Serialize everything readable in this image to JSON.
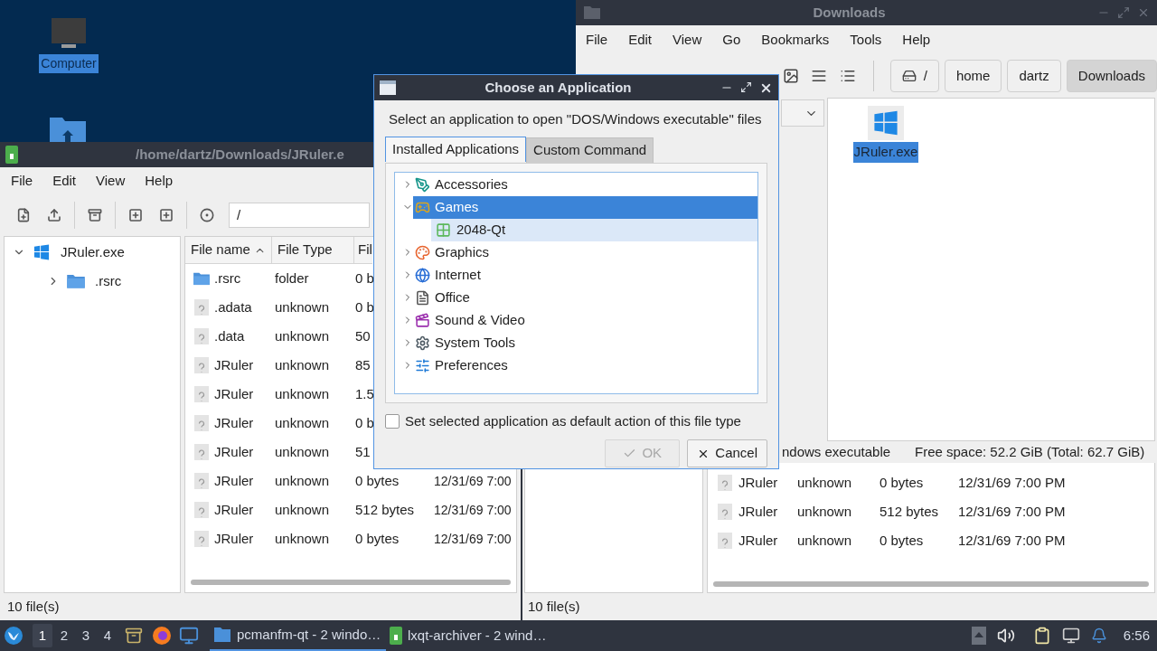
{
  "desktop_icons": [
    {
      "kind": "computer",
      "label": "Computer",
      "selected": true
    },
    {
      "kind": "home-folder",
      "selected": false
    }
  ],
  "archiver_back": {
    "rows": [
      {
        "kind": "unknown",
        "name": "JRuler",
        "type": "unknown",
        "size": "0 bytes",
        "date": "12/31/69 7:00 PM"
      },
      {
        "kind": "unknown",
        "name": "JRuler",
        "type": "unknown",
        "size": "512 bytes",
        "date": "12/31/69 7:00 PM"
      },
      {
        "kind": "unknown",
        "name": "JRuler",
        "type": "unknown",
        "size": "0 bytes",
        "date": "12/31/69 7:00 PM"
      }
    ],
    "status": "10 file(s)"
  },
  "downloads_window": {
    "title": "Downloads",
    "menu": [
      "File",
      "Edit",
      "View",
      "Go",
      "Bookmarks",
      "Tools",
      "Help"
    ],
    "view_buttons": [
      {
        "kind": "thumbnail",
        "selected": false
      },
      {
        "kind": "compact",
        "selected": false
      },
      {
        "kind": "detailed",
        "selected": false
      }
    ],
    "path": [
      {
        "label": "/",
        "kind": "root",
        "selected": false
      },
      {
        "label": "home",
        "kind": "dir",
        "selected": false
      },
      {
        "label": "dartz",
        "kind": "dir",
        "selected": false
      },
      {
        "label": "Downloads",
        "kind": "dir",
        "selected": true
      }
    ],
    "files": [
      {
        "name": "JRuler.exe",
        "selected": true
      }
    ],
    "status": {
      "type_text": "ndows executable",
      "free_space": "Free space: 52.2 GiB (Total: 62.7 GiB)"
    }
  },
  "archiver_window": {
    "title": "/home/dartz/Downloads/JRuler.e",
    "menu": [
      "File",
      "Edit",
      "View",
      "Help"
    ],
    "path_value": "/",
    "tree": [
      {
        "label": "JRuler.exe",
        "kind": "exe",
        "expanded": true,
        "children": [
          {
            "label": ".rsrc",
            "kind": "folder",
            "expanded": false
          }
        ]
      }
    ],
    "columns": [
      {
        "label": "File name",
        "sorted": true
      },
      {
        "label": "File Type",
        "sorted": false
      },
      {
        "label": "Fil",
        "sorted": false
      }
    ],
    "rows": [
      {
        "kind": "folder",
        "name": ".rsrc",
        "type": "folder",
        "size": "0 b"
      },
      {
        "kind": "unknown",
        "name": ".adata",
        "type": "unknown",
        "size": "0 b"
      },
      {
        "kind": "unknown",
        "name": ".data",
        "type": "unknown",
        "size": "50"
      },
      {
        "kind": "unknown",
        "name": "JRuler",
        "type": "unknown",
        "size": "85"
      },
      {
        "kind": "unknown",
        "name": "JRuler",
        "type": "unknown",
        "size": "1.5"
      },
      {
        "kind": "unknown",
        "name": "JRuler",
        "type": "unknown",
        "size": "0 b"
      },
      {
        "kind": "unknown",
        "name": "JRuler",
        "type": "unknown",
        "size": "51"
      },
      {
        "kind": "unknown",
        "name": "JRuler",
        "type": "unknown",
        "size": "0 bytes",
        "date": "12/31/69 7:00"
      },
      {
        "kind": "unknown",
        "name": "JRuler",
        "type": "unknown",
        "size": "512 bytes",
        "date": "12/31/69 7:00"
      },
      {
        "kind": "unknown",
        "name": "JRuler",
        "type": "unknown",
        "size": "0 bytes",
        "date": "12/31/69 7:00"
      }
    ],
    "status": "10 file(s)"
  },
  "dialog": {
    "title": "Choose an Application",
    "prompt": "Select an application to open \"DOS/Windows executable\" files",
    "tabs": [
      {
        "label": "Installed Applications",
        "selected": true
      },
      {
        "label": "Custom Command",
        "selected": false
      }
    ],
    "categories": [
      {
        "label": "Accessories",
        "kind": "accessories",
        "expanded": false,
        "selected": false
      },
      {
        "label": "Games",
        "kind": "games",
        "expanded": true,
        "selected": true,
        "children": [
          {
            "label": "2048-Qt",
            "kind": "tile",
            "selected": false,
            "hovered": true
          }
        ]
      },
      {
        "label": "Graphics",
        "kind": "graphics",
        "expanded": false,
        "selected": false
      },
      {
        "label": "Internet",
        "kind": "internet",
        "expanded": false,
        "selected": false
      },
      {
        "label": "Office",
        "kind": "office",
        "expanded": false,
        "selected": false
      },
      {
        "label": "Sound & Video",
        "kind": "media",
        "expanded": false,
        "selected": false
      },
      {
        "label": "System Tools",
        "kind": "system",
        "expanded": false,
        "selected": false
      },
      {
        "label": "Preferences",
        "kind": "preferences",
        "expanded": false,
        "selected": false
      }
    ],
    "default_checkbox": {
      "label": "Set selected application as default action of this file type",
      "checked": false
    },
    "buttons": [
      {
        "label": "OK",
        "kind": "ok",
        "disabled": true
      },
      {
        "label": "Cancel",
        "kind": "cancel",
        "disabled": false
      }
    ]
  },
  "taskbar": {
    "workspaces": [
      {
        "label": "1",
        "selected": true
      },
      {
        "label": "2",
        "selected": false
      },
      {
        "label": "3",
        "selected": false
      },
      {
        "label": "4",
        "selected": false
      }
    ],
    "tasks": [
      {
        "label": "pcmanfm-qt - 2 windo…",
        "kind": "folder",
        "selected": true
      },
      {
        "label": "lxqt-archiver - 2 wind…",
        "kind": "archive",
        "selected": false
      }
    ],
    "clock": "6:56"
  }
}
